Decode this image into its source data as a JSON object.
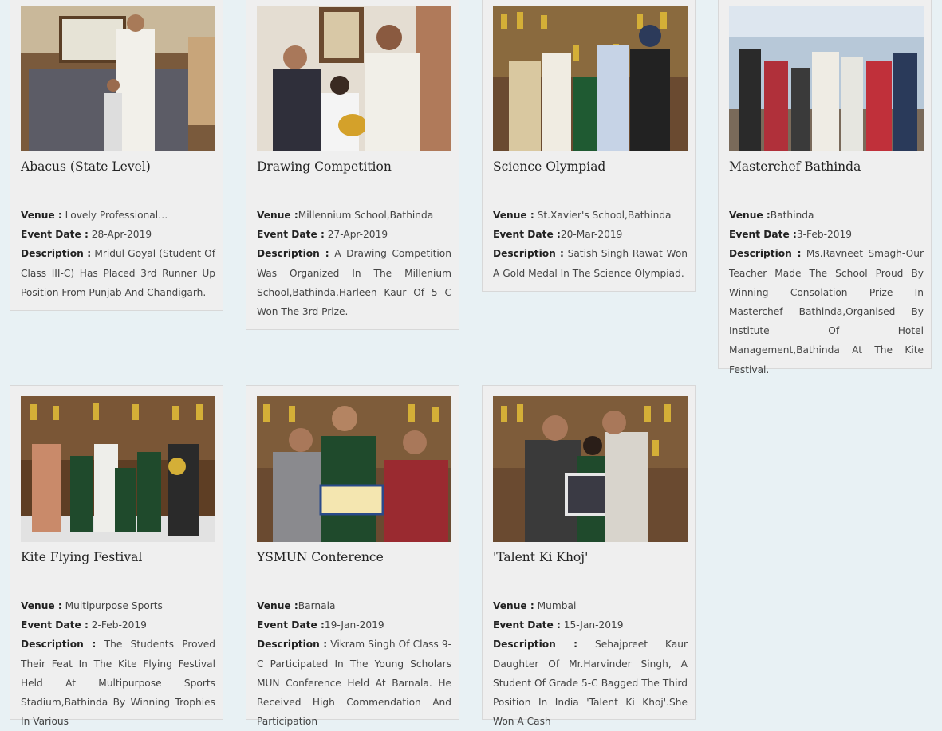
{
  "labels": {
    "venue": "Venue :",
    "event_date": "Event Date :",
    "description": "Description :"
  },
  "events": [
    {
      "title": "Abacus (State Level)",
      "venue": "Lovely Professional…",
      "date": "28-Apr-2019",
      "description": "Mridul Goyal (Student Of Class III-C) Has Placed 3rd Runner Up Position From Punjab And Chandigarh."
    },
    {
      "title": "Drawing Competition",
      "venue": "Millennium School,Bathinda",
      "date": "27-Apr-2019",
      "description": "A Drawing Competition Was Organized In The Millenium School,Bathinda.Harleen Kaur Of 5 C Won The 3rd Prize."
    },
    {
      "title": "Science Olympiad",
      "venue": "St.Xavier's School,Bathinda",
      "date": "20-Mar-2019",
      "description": "Satish Singh Rawat Won A Gold Medal In The Science Olympiad."
    },
    {
      "title": "Masterchef Bathinda",
      "venue": "Bathinda",
      "date": "3-Feb-2019",
      "description": "Ms.Ravneet Smagh-Our Teacher Made The School Proud By Winning Consolation Prize In Masterchef Bathinda,Organised By Institute Of Hotel Management,Bathinda At The Kite Festival."
    },
    {
      "title": "Kite Flying Festival",
      "venue": "Multipurpose Sports",
      "date": "2-Feb-2019",
      "description": "The Students Proved Their Feat In The Kite Flying Festival Held At Multipurpose Sports Stadium,Bathinda By Winning Trophies In Various"
    },
    {
      "title": "YSMUN Conference",
      "venue": "Barnala",
      "date": "19-Jan-2019",
      "description": "Vikram Singh Of Class 9-C Participated In The Young Scholars MUN Conference Held At Barnala. He Received High Commendation And Participation"
    },
    {
      "title": "'Talent Ki Khoj'",
      "venue": "Mumbai",
      "date": "15-Jan-2019",
      "description": "Sehajpreet Kaur Daughter Of Mr.Harvinder Singh, A Student Of Grade 5-C Bagged The Third Position In India 'Talent Ki Khoj'.She Won A Cash"
    }
  ],
  "colors": {
    "page_bg": "#e8f1f4",
    "card_bg": "#efefef",
    "card_border": "#d8d8d8",
    "title": "#222222",
    "text": "#444444"
  }
}
